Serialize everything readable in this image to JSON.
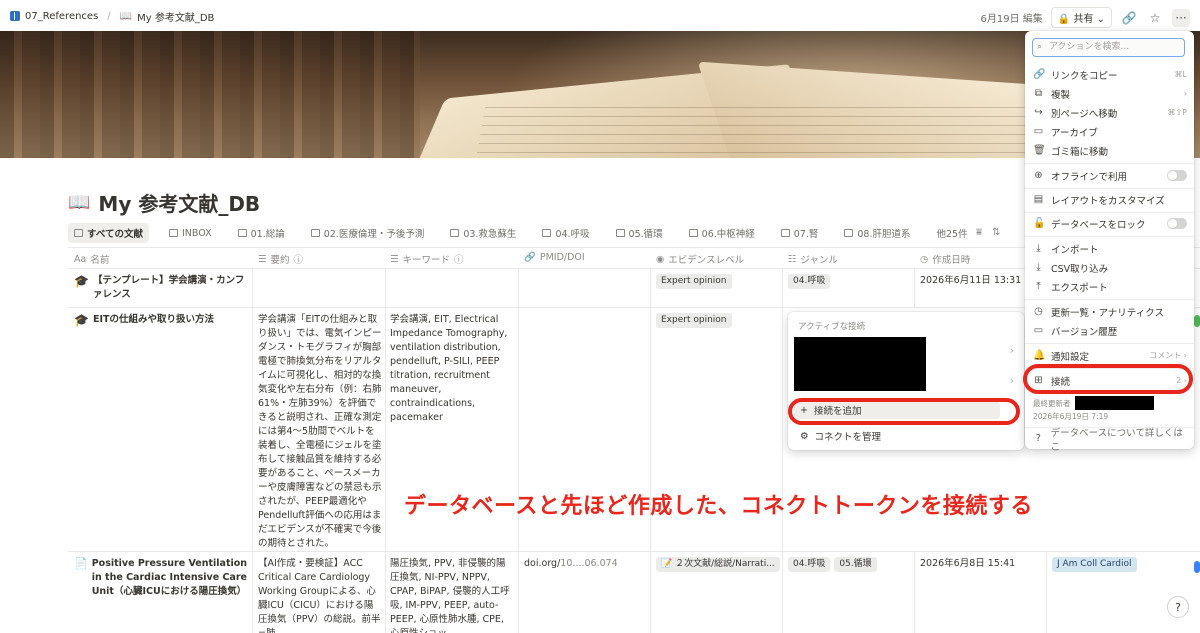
{
  "breadcrumb": {
    "parent": "07_References",
    "current": "My 参考文献_DB",
    "current_icon": "📖"
  },
  "topbar": {
    "edited": "6月19日 編集",
    "share": "共有"
  },
  "page": {
    "title_icon": "📖",
    "title": "My 参考文献_DB"
  },
  "tabs": [
    {
      "label": "すべての文献"
    },
    {
      "label": "INBOX"
    },
    {
      "label": "01.総論"
    },
    {
      "label": "02.医療倫理・予後予測"
    },
    {
      "label": "03.救急蘇生"
    },
    {
      "label": "04.呼吸"
    },
    {
      "label": "05.循環"
    },
    {
      "label": "06.中枢神経"
    },
    {
      "label": "07.腎"
    },
    {
      "label": "08.肝胆道系"
    }
  ],
  "tabs_more": "他25件",
  "columns": {
    "name": "名前",
    "summary": "要約",
    "keywords": "キーワード",
    "pmid": "PMID/DOI",
    "evidence": "エビデンスレベル",
    "genre": "ジャンル",
    "created": "作成日時"
  },
  "rows": [
    {
      "icon": "🎓",
      "name": "【テンプレート】学会講演・カンファレンス",
      "summary": "",
      "keywords": "",
      "pmid": "",
      "evidence": "Expert opinion",
      "genre": [
        "04.呼吸"
      ],
      "created": "2026年6月11日 13:31"
    },
    {
      "icon": "🎓",
      "name": "EITの仕組みや取り扱い方法",
      "summary": "学会講演「EITの仕組みと取り扱い」では、電気インピーダンス・トモグラフィが胸部電極で肺換気分布をリアルタイムに可視化し、相対的な換気変化や左右分布（例：右肺61%・左肺39%）を評価できると説明され、正確な測定には第4〜5肋間でベルトを装着し、全電極にジェルを塗布して接触品質を維持する必要があること、ペースメーカーや皮膚障害などの禁忌も示されたが、PEEP最適化やPendelluft評価への応用はまだエビデンスが不確実で今後の期待とされた。",
      "keywords": "学会講演, EIT, Electrical Impedance Tomography, ventilation distribution, pendelluft, P-SILI, PEEP titration, recruitment maneuver, contraindications, pacemaker",
      "pmid": "",
      "evidence": "Expert opinion",
      "genre": [],
      "created": ""
    },
    {
      "icon": "📄",
      "name": "Positive Pressure Ventilation in the Cardiac Intensive Care Unit（心臓ICUにおける陽圧換気）",
      "summary": "【AI作成・要検証】ACC Critical Care Cardiology Working Groupによる、心臓ICU（CICU）における陽圧換気（PPV）の総説。前半=肺",
      "keywords": "陽圧換気, PPV, 非侵襲的陽圧換気, NI-PPV, NPPV, CPAP, BiPAP, 侵襲的人工呼吸, IM-PPV, PEEP, auto-PEEP, 心原性肺水腫, CPE, 心原性ショッ",
      "pmid_prefix": "doi.org/",
      "pmid_rest": "10....06.074",
      "evidence": "２次文献/総説/Narrati...",
      "evidence_icon": "📝",
      "genre": [
        "04.呼吸",
        "05.循環"
      ],
      "created": "2026年6月8日 15:41",
      "journal": "J Am Coll Cardiol"
    }
  ],
  "connection_popup": {
    "header": "アクティブな接続",
    "add": "接続を追加",
    "manage": "コネクトを管理"
  },
  "action_menu": {
    "search_placeholder": "アクションを検索...",
    "items": [
      {
        "label": "リンクをコピー",
        "shortcut": "⌘L"
      },
      {
        "label": "複製",
        "shortcut": "›"
      },
      {
        "label": "別ページへ移動",
        "shortcut": "⌘⇧P"
      },
      {
        "label": "アーカイブ"
      },
      {
        "label": "ゴミ箱に移動"
      },
      {
        "label": "オフラインで利用"
      },
      {
        "label": "レイアウトをカスタマイズ"
      },
      {
        "label": "データベースをロック"
      },
      {
        "label": "インポート"
      },
      {
        "label": "CSV取り込み"
      },
      {
        "label": "エクスポート"
      },
      {
        "label": "更新一覧・アナリティクス"
      },
      {
        "label": "バージョン履歴"
      },
      {
        "label": "通知設定",
        "shortcut": "コメント ›"
      },
      {
        "label": "接続",
        "shortcut": "2 ›"
      },
      {
        "label": "データベースについて詳しくはこ"
      }
    ],
    "last_updated_label": "最終更新者",
    "last_updated_date": "2026年6月19日 7:19"
  },
  "annotation": "データベースと先ほど作成した、コネクトトークンを接続する",
  "colors": {
    "annotation_red": "#e8261c",
    "accent_blue": "#2f6fd0"
  }
}
